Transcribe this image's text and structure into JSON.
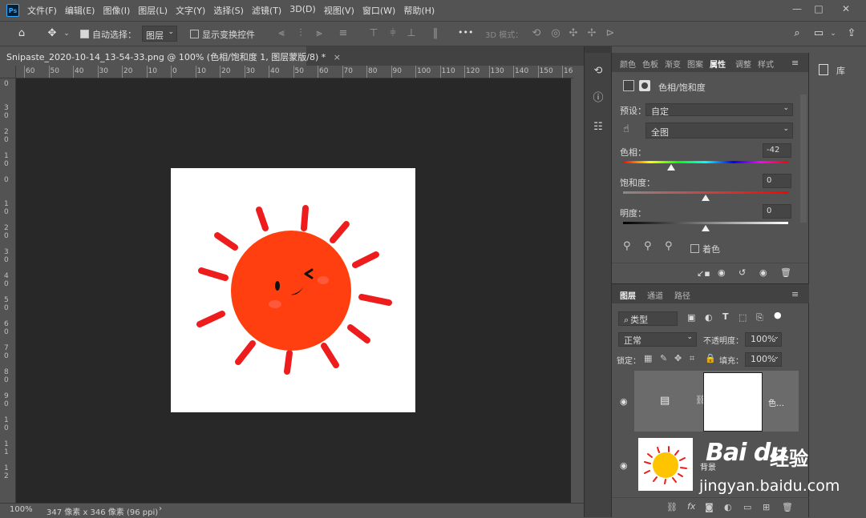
{
  "app": {
    "logo_text": "Ps"
  },
  "menu": [
    "文件(F)",
    "编辑(E)",
    "图像(I)",
    "图层(L)",
    "文字(Y)",
    "选择(S)",
    "滤镜(T)",
    "3D(D)",
    "视图(V)",
    "窗口(W)",
    "帮助(H)"
  ],
  "window_controls": {
    "minimize": "—",
    "maximize": "□",
    "close": "✕"
  },
  "options_bar": {
    "auto_select_label": "自动选择：",
    "auto_select_value": "图层",
    "show_transform_label": "显示变换控件",
    "more": "•••",
    "mode_3d_label": "3D 模式："
  },
  "document_tab": {
    "title": "Snipaste_2020-10-14_13-54-33.png @ 100% (色相/饱和度 1, 图层蒙版/8) *",
    "close": "×"
  },
  "ruler_h_labels": [
    "60",
    "50",
    "40",
    "30",
    "20",
    "10",
    "0",
    "10",
    "20",
    "30",
    "40",
    "50",
    "60",
    "70",
    "80",
    "90",
    "100",
    "110",
    "120",
    "130",
    "140",
    "150",
    "16"
  ],
  "ruler_v_labels": [
    "0",
    "3\n0",
    "2\n0",
    "1\n0",
    "0",
    "1\n0",
    "2\n0",
    "3\n0",
    "4\n0",
    "5\n0",
    "6\n0",
    "7\n0",
    "8\n0",
    "9\n0",
    "1\n0",
    "1\n1",
    "1\n2"
  ],
  "status": {
    "zoom": "100%",
    "doc_size": "347 像素 x 346 像素 (96 ppi)",
    "arrow": "›"
  },
  "panel_tabs": {
    "items": [
      "颜色",
      "色板",
      "渐变",
      "图案",
      "属性",
      "调整",
      "样式"
    ],
    "active": "属性"
  },
  "properties": {
    "adjustment_name": "色相/饱和度",
    "preset_label": "预设：",
    "preset_value": "自定",
    "channel_value": "全图",
    "hue_label": "色相：",
    "hue_value": "-42",
    "hue_position": 0.29,
    "saturation_label": "饱和度：",
    "saturation_value": "0",
    "saturation_position": 0.5,
    "lightness_label": "明度：",
    "lightness_value": "0",
    "lightness_position": 0.5,
    "colorize_label": "着色"
  },
  "library": {
    "label": "库"
  },
  "layers_tabs": {
    "items": [
      "图层",
      "通道",
      "路径"
    ],
    "active": "图层"
  },
  "layers_panel": {
    "filter_label": "类型",
    "blend_mode": "正常",
    "opacity_label": "不透明度：",
    "opacity_value": "100%",
    "lock_label": "锁定：",
    "fill_label": "填充：",
    "fill_value": "100%",
    "layers": [
      {
        "name": "色…",
        "selected": true
      },
      {
        "name": "背景",
        "selected": false
      }
    ]
  },
  "watermark": {
    "brand": "Bai  du",
    "brand_cn": "经验",
    "url": "jingyan.baidu.com"
  },
  "colors": {
    "accent_ps": "#31a8ff",
    "sun": "#ff3f10",
    "ray": "#ee1d1d"
  }
}
